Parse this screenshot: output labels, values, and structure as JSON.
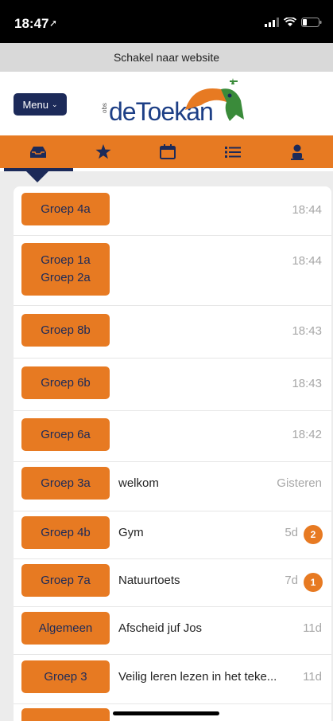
{
  "status_bar": {
    "time": "18:47"
  },
  "website_bar": {
    "label": "Schakel naar website"
  },
  "header": {
    "menu_label": "Menu",
    "logo_small": "obs",
    "logo_text": "deToekan"
  },
  "tabs": [
    {
      "icon": "inbox-icon"
    },
    {
      "icon": "star-icon"
    },
    {
      "icon": "calendar-icon"
    },
    {
      "icon": "list-icon"
    },
    {
      "icon": "person-icon"
    }
  ],
  "colors": {
    "accent": "#e77a22",
    "navy": "#1c2a59"
  },
  "messages": [
    {
      "group": "Groep 4a",
      "subject": "",
      "time": "18:44",
      "badge": ""
    },
    {
      "group": "Groep 1a",
      "group2": "Groep 2a",
      "subject": "",
      "time": "18:44",
      "badge": ""
    },
    {
      "group": "Groep 8b",
      "subject": "",
      "time": "18:43",
      "badge": ""
    },
    {
      "group": "Groep 6b",
      "subject": "",
      "time": "18:43",
      "badge": ""
    },
    {
      "group": "Groep 6a",
      "subject": "",
      "time": "18:42",
      "badge": ""
    },
    {
      "group": "Groep 3a",
      "subject": "welkom",
      "time": "Gisteren",
      "badge": ""
    },
    {
      "group": "Groep 4b",
      "subject": "Gym",
      "time": "5d",
      "badge": "2"
    },
    {
      "group": "Groep 7a",
      "subject": "Natuurtoets",
      "time": "7d",
      "badge": "1"
    },
    {
      "group": "Algemeen",
      "subject": "Afscheid juf Jos",
      "time": "11d",
      "badge": ""
    },
    {
      "group": "Groep 3",
      "subject": "Veilig leren lezen in het teke...",
      "time": "11d",
      "badge": ""
    }
  ]
}
